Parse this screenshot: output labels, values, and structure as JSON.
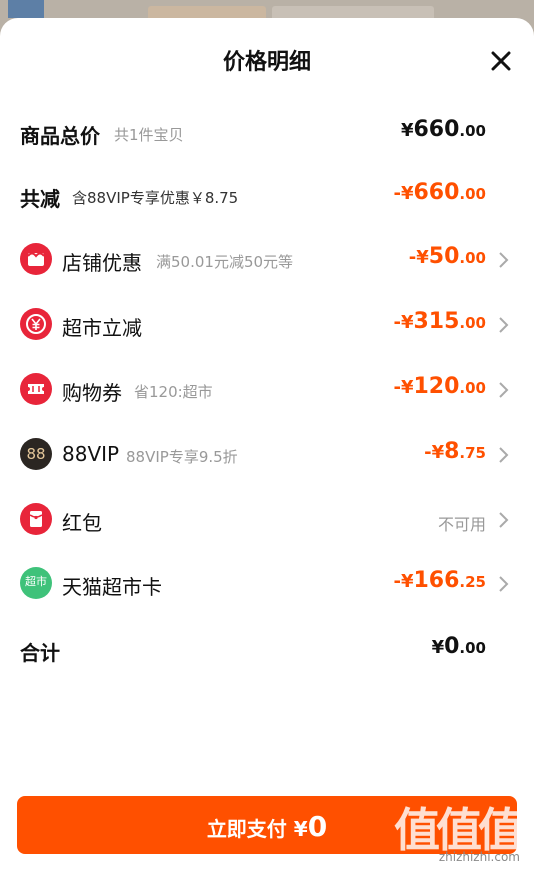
{
  "sheet": {
    "title": "价格明细"
  },
  "rows": {
    "total_goods": {
      "label": "商品总价",
      "sub": "共1件宝贝",
      "sym": "¥",
      "int": "660",
      "dec": ".00"
    },
    "total_discount": {
      "label": "共减",
      "sub": "含88VIP专享优惠￥8.75",
      "sym": "-¥",
      "int": "660",
      "dec": ".00"
    },
    "shop": {
      "label": "店铺优惠",
      "sub": "满50.01元减50元等",
      "sym": "-¥",
      "int": "50",
      "dec": ".00",
      "icon": "shop-discount-icon"
    },
    "supermarket": {
      "label": "超市立减",
      "sub": "",
      "sym": "-¥",
      "int": "315",
      "dec": ".00",
      "icon": "yuan-coin-icon"
    },
    "coupon": {
      "label": "购物券",
      "sub": "省120:超市",
      "sym": "-¥",
      "int": "120",
      "dec": ".00",
      "icon": "ticket-icon"
    },
    "vip": {
      "label": "88VIP",
      "sub": "88VIP专享9.5折",
      "sym": "-¥",
      "int": "8",
      "dec": ".75",
      "icon_text": "88"
    },
    "redpacket": {
      "label": "红包",
      "status": "不可用",
      "icon": "red-packet-icon"
    },
    "card": {
      "label": "天猫超市卡",
      "sym": "-¥",
      "int": "166",
      "dec": ".25",
      "icon_text": "超市"
    },
    "sum": {
      "label": "合计",
      "sym": "¥",
      "int": "0",
      "dec": ".00"
    }
  },
  "pay_button": {
    "label": "立即支付",
    "sym": "¥",
    "amount": "0"
  },
  "watermark": {
    "text": "值值值",
    "url": "zhizhizhi.com"
  },
  "colors": {
    "accent": "#ff5000",
    "icon_red": "#e8253a",
    "vip_dark": "#2b2622",
    "card_green": "#3fc27a"
  }
}
